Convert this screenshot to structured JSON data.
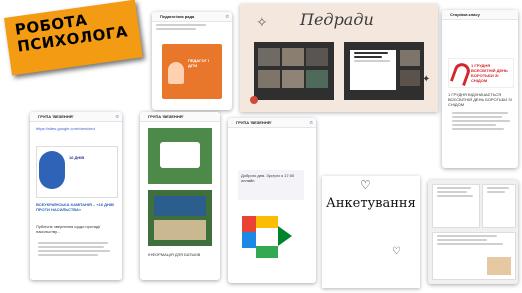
{
  "banner": {
    "line1": "РОБОТА",
    "line2": "ПСИХОЛОГА"
  },
  "pedrady": {
    "title": "Педради"
  },
  "chat1": {
    "header": "Педагогічна рада",
    "tile_text": "ПЕДАГОГ І ДІТИ"
  },
  "chat2": {
    "header": "ГРУПА 'ВЕЗЕННЯ'",
    "link": "https://sites.google.com/view/sed",
    "campaign_text": "ВСЕУКРАЇНСЬКА КАМПАНІЯ – «16 ДНІВ ПРОТИ НАСИЛЬСТВА»",
    "body_text": "Публічне звернення щодо протидії насильству..."
  },
  "chat3": {
    "header": "ГРУПА 'ВЕЗЕННЯ'",
    "caption": "ІНФОРМАЦІЯ ДЛЯ БАТЬКІВ"
  },
  "chat4": {
    "header": "ГРУПА 'ВЕЗЕННЯ'",
    "text": "Доброго дня. Зустріч о 17:00 онлайн"
  },
  "aids": {
    "header": "Сторінка класу",
    "title": "1 ГРУДНЯ ВСЕСВІТНІЙ ДЕНЬ БОРОТЬБИ ЗІ СНІДОМ",
    "text": "1 ГРУДНЯ ВІДЗНАЧАЄТЬСЯ ВСЕСВІТНІЙ ДЕНЬ БОРОТЬБИ ЗІ СНІДОМ"
  },
  "survey": {
    "title": "Анкетування"
  },
  "colors": {
    "banner_orange": "#f49b14",
    "viber_purple": "#7360f2",
    "orange_tile": "#e8762b",
    "aids_red": "#d7252c"
  }
}
